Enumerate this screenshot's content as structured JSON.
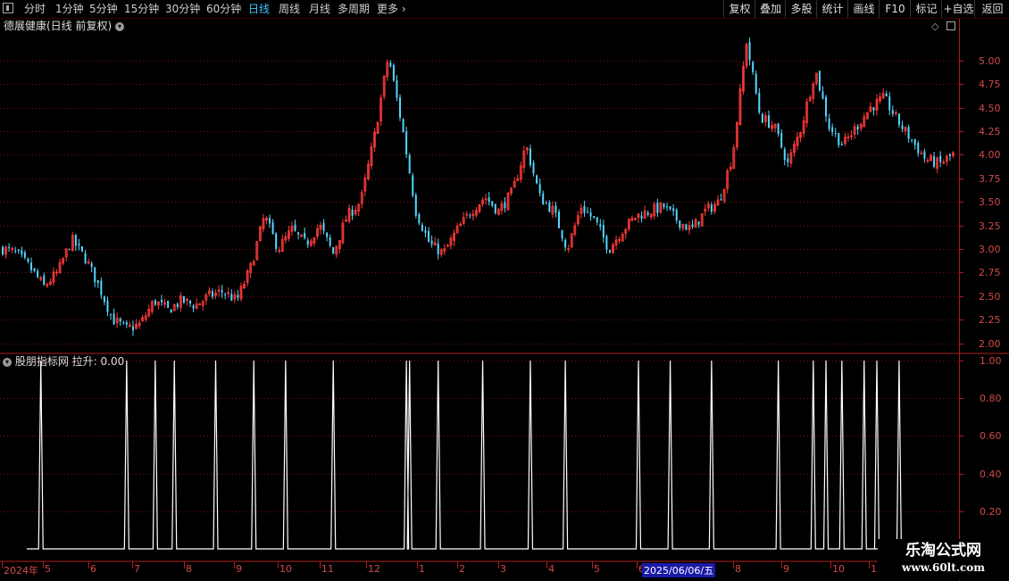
{
  "toolbar": {
    "periods": [
      "分时",
      "1分钟",
      "5分钟",
      "15分钟",
      "30分钟",
      "60分钟",
      "日线",
      "周线",
      "月线",
      "多周期",
      "更多"
    ],
    "active_period": "日线",
    "right_buttons": [
      "复权",
      "叠加",
      "多股",
      "统计",
      "画线",
      "F10",
      "标记",
      "+自选",
      "返回"
    ]
  },
  "main_panel": {
    "title": "德展健康(日线 前复权)",
    "y_ticks": [
      "5.00",
      "4.75",
      "4.50",
      "4.25",
      "4.00",
      "3.75",
      "3.50",
      "3.25",
      "3.00",
      "2.75",
      "2.50",
      "2.25",
      "2.00"
    ]
  },
  "indicator_panel": {
    "title": "股朋指标网",
    "value_label": "拉升: 0.00",
    "y_ticks": [
      "1.00",
      "0.80",
      "0.60",
      "0.40",
      "0.20"
    ]
  },
  "x_axis": {
    "labels": [
      "2024年",
      "5",
      "6",
      "7",
      "8",
      "9",
      "10",
      "11",
      "12",
      "1",
      "2",
      "3",
      "4",
      "5",
      "6",
      "8",
      "9",
      "10",
      "1"
    ],
    "cursor_date": "2025/06/06/五"
  },
  "watermark": {
    "line1": "乐淘公式网",
    "line2": "www.60lt.com"
  },
  "colors": {
    "up": "#ff3b3b",
    "down": "#54d7ff",
    "axis": "#b01c1c",
    "grid": "#7a1010",
    "line": "#ffffff",
    "active": "#3fc4ff"
  },
  "chart_data": {
    "type": "candlestick",
    "price_ylim": [
      2.0,
      5.0
    ],
    "price_keypoints": [
      3.0,
      2.95,
      2.8,
      2.6,
      2.75,
      3.1,
      2.9,
      2.6,
      2.25,
      2.15,
      2.2,
      2.45,
      2.35,
      2.45,
      2.4,
      2.5,
      2.55,
      2.45,
      2.8,
      3.35,
      3.0,
      3.2,
      3.05,
      3.25,
      2.95,
      3.35,
      3.5,
      4.2,
      5.05,
      4.3,
      3.4,
      3.05,
      2.95,
      3.2,
      3.4,
      3.55,
      3.4,
      3.6,
      4.1,
      3.55,
      3.4,
      3.0,
      3.45,
      3.3,
      3.0,
      3.2,
      3.35,
      3.4,
      3.45,
      3.3,
      3.2,
      3.4,
      3.5,
      4.0,
      5.2,
      4.4,
      4.3,
      3.9,
      4.3,
      4.9,
      4.3,
      4.1,
      4.3,
      4.5,
      4.6,
      4.35,
      4.15,
      3.95,
      3.9,
      4.0
    ],
    "indicator_ylim": [
      0,
      1.0
    ],
    "indicator_series": "拉升",
    "signal_bars": [
      12,
      39,
      48,
      54,
      67,
      79,
      89,
      104,
      127,
      128,
      137,
      151,
      166,
      177,
      200,
      210,
      223,
      244,
      255,
      259,
      264,
      271,
      275,
      282
    ],
    "signal_value": 1.0
  }
}
